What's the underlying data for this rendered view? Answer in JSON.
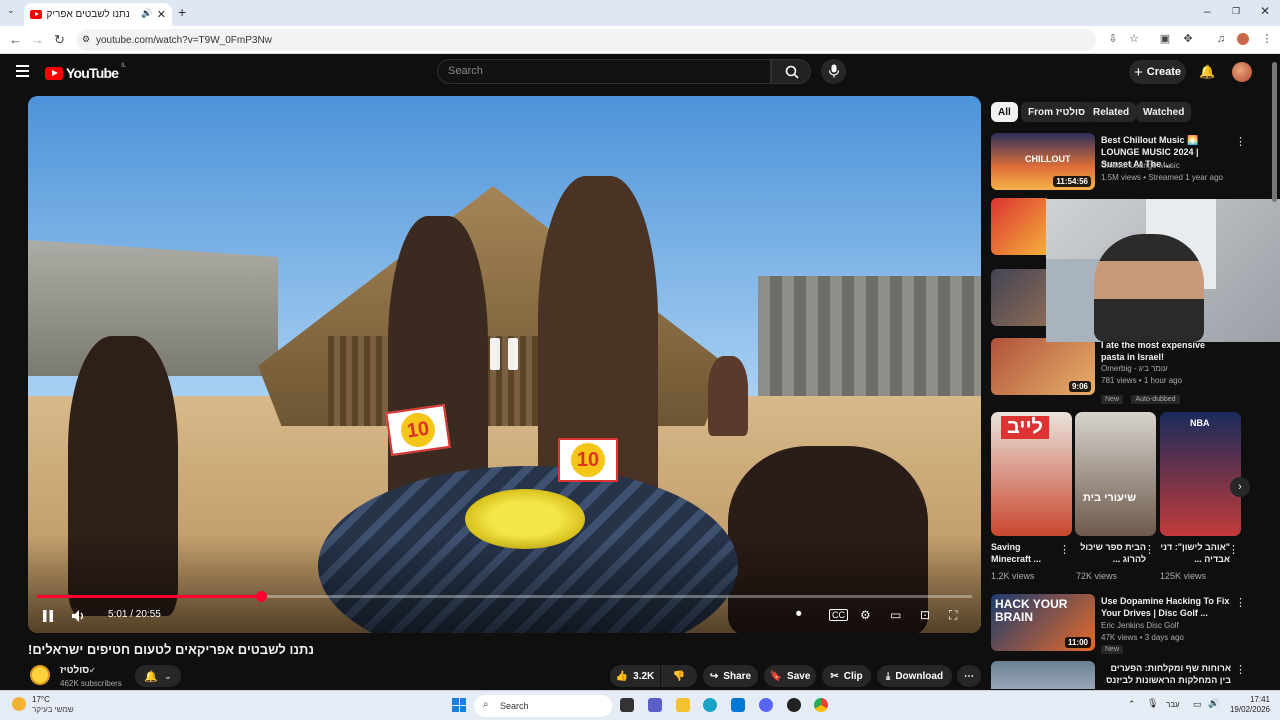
{
  "browser": {
    "tab_title": "נתנו לשבטים אפריקאים לט",
    "url": "youtube.com/watch?v=T9W_0FmP3Nw"
  },
  "youtube": {
    "logo_text": "YouTube",
    "logo_country": "IL",
    "search_placeholder": "Search",
    "create_label": "Create"
  },
  "player": {
    "time_current": "5:01",
    "time_total": "20:55",
    "time_display": "5:01 / 20:55",
    "progress_fraction": 0.24,
    "card_label": "10"
  },
  "video": {
    "title": "נתנו לשבטים אפריקאים לטעום חטיפים ישראלים!",
    "channel_name": "סולטיז",
    "subscribers": "462K subscribers",
    "likes": "3.2K",
    "share_label": "Share",
    "save_label": "Save",
    "clip_label": "Clip",
    "download_label": "Download"
  },
  "chips": [
    "All",
    "From סולטיז",
    "Related",
    "Watched"
  ],
  "recommendations": [
    {
      "title": "Best Chillout Music 🌅 LOUNGE MUSIC 2024 | Sunset At The ...",
      "channel": "Chillout Lounge Music",
      "meta": "1.5M views • Streamed 1 year ago",
      "duration": "11:54:56",
      "thumb_text": "CHILLOUT",
      "thumb_color": "#e0703a"
    },
    {
      "title": "I ate the most expensive pasta in Israel!",
      "channel": "Omerbig - עומר ביג",
      "meta": "781 views • 1 hour ago",
      "duration": "9:06",
      "badges": [
        "New",
        "Auto-dubbed"
      ],
      "thumb_color": "#b0523a"
    },
    {
      "title": "Use Dopamine Hacking To Fix Your Drives | Disc Golf ...",
      "channel": "Eric Jenkins Disc Golf",
      "meta": "47K views • 3 days ago",
      "duration": "11:00",
      "badges": [
        "New"
      ],
      "thumb_text": "HACK YOUR BRAIN",
      "thumb_color": "#2c4f86"
    },
    {
      "title": "ארוחות שף ומקלחות: הפערים בין המחלקות הראשונות לביזנס",
      "thumb_color": "#6b7f94"
    }
  ],
  "shorts": [
    {
      "title": "Saving Minecraft ...",
      "views": "1.2K views",
      "thumb_text": "לייב",
      "thumb_color": "#c9472f"
    },
    {
      "title": "הבית ספר שיכול להרוג ...",
      "views": "72K views",
      "thumb_text": "שיעורי בית",
      "thumb_color": "#6d5a4c"
    },
    {
      "title": "\"אוהב לישון\": דני אבדיה ...",
      "views": "125K views",
      "thumb_text": "NBA",
      "thumb_color": "#1a2c5c"
    }
  ],
  "taskbar": {
    "temperature": "17°C",
    "weather": "שמשי בעיקר",
    "search_label": "Search",
    "lang": "עבר",
    "time": "17:41",
    "date": "19/02/2026"
  },
  "colors": {
    "progress": "#ff0033",
    "background": "#0f0f0f",
    "chip_active": "#f1f1f1"
  }
}
